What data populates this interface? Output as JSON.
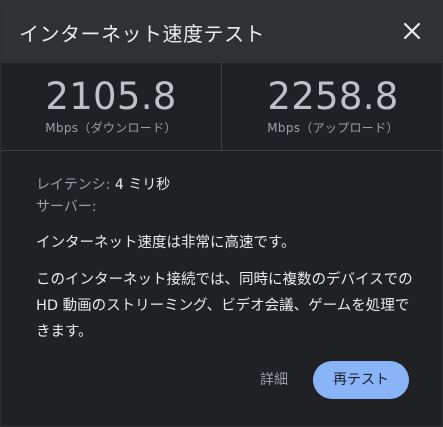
{
  "dialog": {
    "title": "インターネット速度テスト",
    "close_icon": "close-icon"
  },
  "download": {
    "value": "2105.8",
    "unit": "Mbps（ダウンロード）"
  },
  "upload": {
    "value": "2258.8",
    "unit": "Mbps（アップロード）"
  },
  "info": {
    "latency_label": "レイテンシ:",
    "latency_value": "4 ミリ秒",
    "server_label": "サーバー:",
    "summary": "インターネット速度は非常に高速です。",
    "description": "このインターネット接続では、同時に複数のデバイスでの HD 動画のストリーミング、ビデオ会議、ゲームを処理できます。"
  },
  "actions": {
    "details_label": "詳細",
    "retest_label": "再テスト"
  },
  "colors": {
    "accent": "#8ab4f8",
    "background": "#202124",
    "header": "#303134"
  }
}
